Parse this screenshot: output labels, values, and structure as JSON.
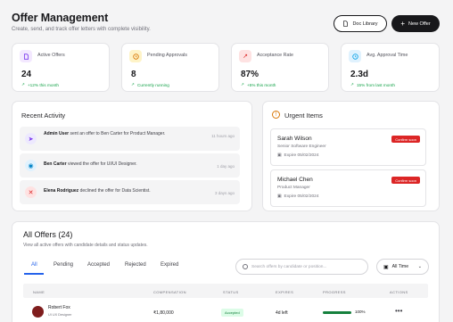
{
  "header": {
    "title": "Offer Management",
    "subtitle": "Create, send, and track offer letters with complete visibility.",
    "doc_library_label": "Doc Library",
    "new_offer_label": "New Offer"
  },
  "stats": [
    {
      "label": "Active Offers",
      "value": "24",
      "trend": "+12% this month",
      "icon": "document-icon",
      "color": "#7c3aed",
      "bg": "#f3e8ff"
    },
    {
      "label": "Pending Approvals",
      "value": "8",
      "trend": "Currently running",
      "icon": "clock-icon",
      "color": "#d97706",
      "bg": "#fef3c7"
    },
    {
      "label": "Acceptance Rate",
      "value": "87%",
      "trend": "+5% this month",
      "icon": "trend-up-icon",
      "color": "#dc2626",
      "bg": "#fee2e2"
    },
    {
      "label": "Avg. Approval Time",
      "value": "2.3d",
      "trend": "15% from last month",
      "icon": "clock-icon",
      "color": "#0ea5e9",
      "bg": "#e0f2fe"
    }
  ],
  "recent_activity": {
    "title": "Recent Activity",
    "items": [
      {
        "actor": "Admin User",
        "text": " sent an offer to Ben Carter for Product Manager.",
        "time": "11 hours ago",
        "icon": "send-icon",
        "color": "#7c3aed",
        "bg": "#ede9fe"
      },
      {
        "actor": "Ben Carter",
        "text": " viewed the offer for UI/UI Designer.",
        "time": "1 day ago",
        "icon": "eye-icon",
        "color": "#0284c7",
        "bg": "#e0f2fe"
      },
      {
        "actor": "Elena Rodriguez",
        "text": " declined the offer for Data Scientist.",
        "time": "3 days ago",
        "icon": "x-icon",
        "color": "#dc2626",
        "bg": "#fee2e2"
      }
    ]
  },
  "urgent": {
    "title": "Urgent Items",
    "items": [
      {
        "name": "Sarah Wilson",
        "role": "Senior Software Engineer",
        "expires": "Expire 05/02/2024",
        "badge": "Confirm soon"
      },
      {
        "name": "Michael Chen",
        "role": "Product Manager",
        "expires": "Expire 05/02/2024",
        "badge": "Confirm soon"
      }
    ]
  },
  "offers": {
    "title": "All Offers (24)",
    "subtitle": "View all active offers with candidate details and status updates.",
    "tabs": [
      "All",
      "Pending",
      "Accepted",
      "Rejected",
      "Expired"
    ],
    "active_tab": "All",
    "search_placeholder": "Search offers by candidate or position...",
    "filter_label": "All Time",
    "columns": [
      "NAME",
      "COMPENSATION",
      "STATUS",
      "EXPIRES",
      "PROGRESS",
      "ACTIONS"
    ],
    "rows": [
      {
        "name": "Robert Fox",
        "role": "UI UX Designer",
        "compensation": "₹1,80,000",
        "status": "Accepted",
        "expires": "4d left",
        "progress": 100,
        "progress_label": "100%"
      }
    ]
  }
}
